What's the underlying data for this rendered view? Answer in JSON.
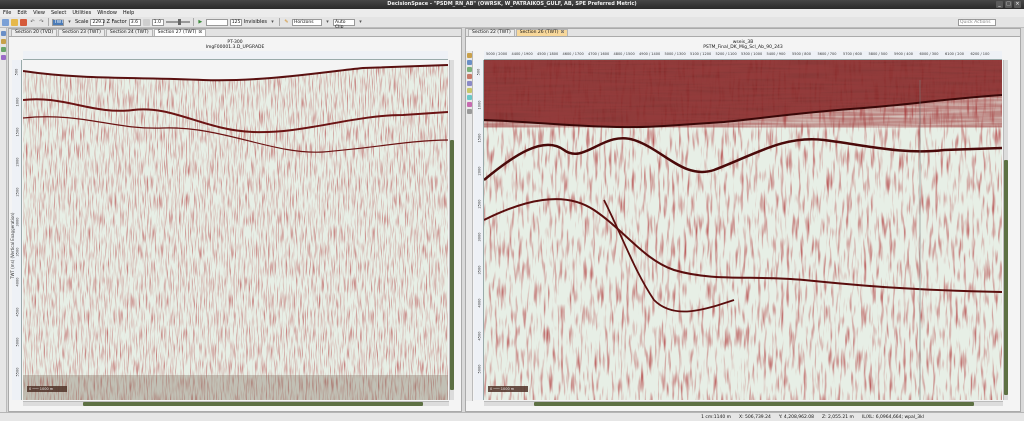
{
  "window": {
    "title": "DecisionSpace - \"PSDM_RN_AB\" (OWRSK, W_PATRAIKOS_GULF, AB, SPE Preferred Metric)"
  },
  "menu": [
    "File",
    "Edit",
    "View",
    "Select",
    "Utilities",
    "Window",
    "Help"
  ],
  "toolbar": {
    "mode_value": "TWT",
    "scale_label": "Scale",
    "scale_value": "229.2",
    "zfactor_label": "Z Factor",
    "zfactor_value": "3.6",
    "step_value": "1.0",
    "zoom_value": "125",
    "invisibles_label": "Invisibles",
    "horizons_value": "Horizons",
    "autoclip_value": "Auto Clip",
    "quick_search_placeholder": "Quick Actions"
  },
  "left_panel": {
    "tabs": [
      {
        "label": "Section 20 (TVD)",
        "active": false
      },
      {
        "label": "Section 23 (TWT)",
        "active": false
      },
      {
        "label": "Section 24 (TWT)",
        "active": false
      },
      {
        "label": "Section 27 (TWT)",
        "active": true
      }
    ],
    "section_title": "PT-300",
    "section_subtitle": "ImgF00001.3.D_UPGRADE",
    "y_axis_label": "TWT (ms) (Vertical Exaggeration)",
    "y_ticks": [
      "500",
      "1000",
      "1500",
      "2000",
      "2500",
      "3000",
      "3500",
      "4000",
      "4500",
      "5000",
      "5500"
    ]
  },
  "right_panel": {
    "tabs": [
      {
        "label": "Section 22 (TWT)",
        "active": false
      },
      {
        "label": "Section 26 (TWT)",
        "active": true
      }
    ],
    "section_title": "wseis_3B",
    "section_subtitle": "PSTM_Final_DK_Mig_Scl_Ab_90_243",
    "y_axis_label": "TWT (ms) (Vertical Exaggeration)",
    "x_ticks": [
      "5000 / 2000",
      "4400 / 1900",
      "4500 / 1800",
      "4600 / 1700",
      "4700 / 1600",
      "4800 / 1500",
      "4900 / 1400",
      "5000 / 1300",
      "5100 / 1200",
      "5200 / 1100",
      "5300 / 1000",
      "5400 / 900",
      "5500 / 800",
      "5600 / 700",
      "5700 / 600",
      "5800 / 500",
      "5900 / 400",
      "6000 / 300",
      "6100 / 200",
      "6200 / 100"
    ],
    "y_ticks": [
      "500",
      "1000",
      "1500",
      "2000",
      "2500",
      "3000",
      "3500",
      "4000",
      "4500",
      "5000"
    ]
  },
  "status": {
    "scale": "1 cm:1140 m",
    "x": "X: 506,739.24",
    "y": "Y: 4,208,962.08",
    "z": "Z: 2,055.21 m",
    "il_xl": "IL/XL: 6,0964,664; wpal_3kl"
  },
  "colors": {
    "trace_dark": "#7a1818",
    "trace_light": "#e7efe6",
    "scroll_thumb": "#5d7043",
    "active_tab": "#f7d79a"
  }
}
